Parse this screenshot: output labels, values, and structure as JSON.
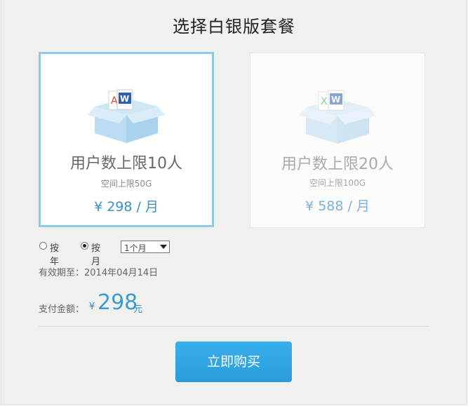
{
  "page": {
    "title": "选择白银版套餐"
  },
  "plans": [
    {
      "users": "用户数上限10人",
      "space": "空间上限50G",
      "price": "¥ 298 / 月",
      "state": "selected"
    },
    {
      "users": "用户数上限20人",
      "space": "空间上限100G",
      "price": "¥ 588 / 月",
      "state": "unselected"
    }
  ],
  "billing": {
    "options": [
      {
        "label": "按年",
        "checked": false
      },
      {
        "label": "按月",
        "checked": true
      }
    ],
    "duration_select": {
      "value": "1个月"
    }
  },
  "expiry": "有效期至：2014年04月14日",
  "payment": {
    "label": "支付金额：",
    "currency": "¥",
    "amount": "298",
    "unit": "元"
  },
  "buy_button": {
    "label": "立即购买"
  },
  "colors": {
    "accent": "#2ea5e6",
    "selected_border": "#8ec9ea",
    "price": "#3a8ec9"
  },
  "icons": {
    "plan_image": "box-with-documents-icon"
  }
}
